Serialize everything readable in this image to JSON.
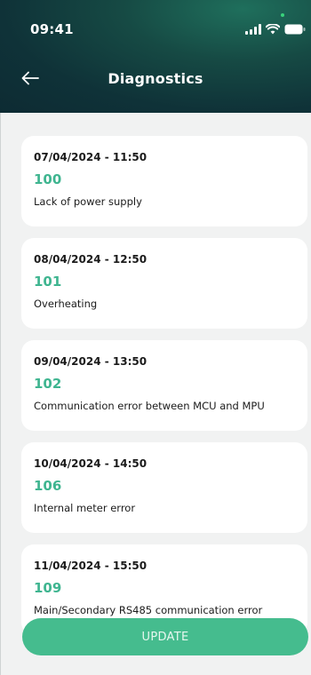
{
  "status_bar": {
    "time": "09:41"
  },
  "header": {
    "title": "Diagnostics",
    "back_icon": "arrow-left-icon"
  },
  "colors": {
    "header_dark": "#0f3238",
    "accent_green": "#3fb590",
    "button_green": "#45bc8e",
    "background": "#f1f2f2",
    "card": "#ffffff"
  },
  "diagnostics": [
    {
      "datetime": "07/04/2024 - 11:50",
      "code": "100",
      "description": "Lack of power supply"
    },
    {
      "datetime": "08/04/2024 - 12:50",
      "code": "101",
      "description": "Overheating"
    },
    {
      "datetime": "09/04/2024 - 13:50",
      "code": "102",
      "description": "Communication error between MCU and MPU"
    },
    {
      "datetime": "10/04/2024 - 14:50",
      "code": "106",
      "description": "Internal meter error"
    },
    {
      "datetime": "11/04/2024 - 15:50",
      "code": "109",
      "description": "Main/Secondary RS485 communication error"
    }
  ],
  "footer": {
    "update_label": "UPDATE"
  }
}
